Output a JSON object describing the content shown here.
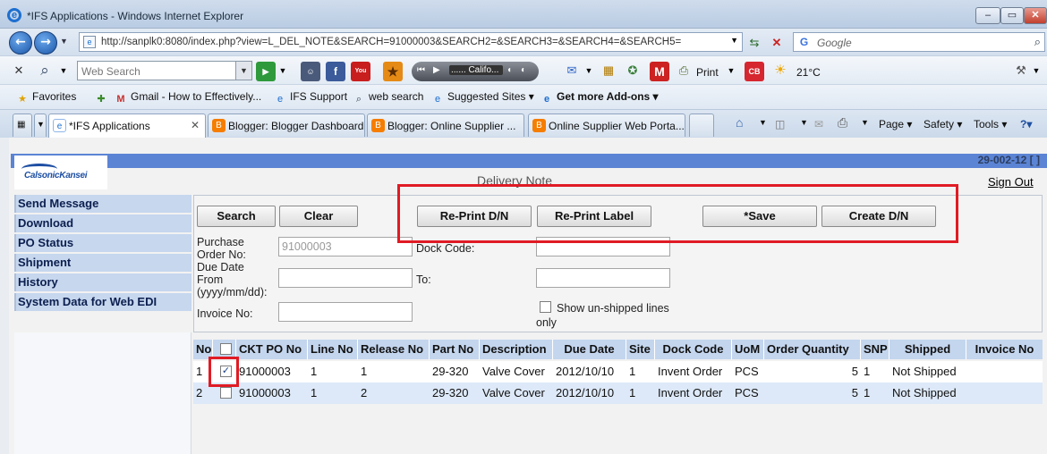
{
  "window": {
    "title": "*IFS Applications - Windows Internet Explorer",
    "controls": {
      "minimize": "–",
      "maximize": "▭",
      "close": "✕"
    }
  },
  "address": {
    "url": "http://sanplk0:8080/index.php?view=L_DEL_NOTE&SEARCH=91000003&SEARCH2=&SEARCH3=&SEARCH4=&SEARCH5=",
    "search_placeholder": "Google"
  },
  "toolbar": {
    "web_search_placeholder": "Web Search",
    "media_station": "...... Califo...",
    "print_label": "Print",
    "cb_label": "CB",
    "weather": "21°C"
  },
  "favorites": {
    "favorites_label": "Favorites",
    "items": [
      "Gmail - How to Effectively...",
      "IFS Support",
      "web search",
      "Suggested Sites ▾",
      "Get more Add-ons ▾"
    ]
  },
  "tabs": [
    {
      "label": "*IFS Applications",
      "active": true
    },
    {
      "label": "Blogger: Blogger Dashboard"
    },
    {
      "label": "Blogger: Online Supplier ..."
    },
    {
      "label": "Online Supplier Web Porta..."
    }
  ],
  "commands": {
    "page": "Page ▾",
    "safety": "Safety ▾",
    "tools": "Tools ▾",
    "help": "?▾"
  },
  "app": {
    "logo_text": "CalsonicKansei",
    "header_code": "29-002-12 [ ]",
    "page_title": "Delivery Note",
    "sign_out": "Sign Out",
    "sidebar": [
      "Send Message",
      "Download",
      "PO Status",
      "Shipment",
      "History",
      "System Data for Web EDI"
    ],
    "buttons": {
      "search": "Search",
      "clear": "Clear",
      "reprint_dn": "Re-Print D/N",
      "reprint_label": "Re-Print Label",
      "save": "*Save",
      "create_dn": "Create D/N"
    },
    "form": {
      "po_label_1": "Purchase",
      "po_label_2": "Order No:",
      "po_value": "91000003",
      "dock_code_label": "Dock Code:",
      "due_label_1": "Due Date",
      "due_label_2": "From",
      "due_label_3": "(yyyy/mm/dd):",
      "to_label": "To:",
      "invoice_label": "Invoice No:",
      "show_unshipped_1": "Show un-shipped lines",
      "show_unshipped_2": "only"
    },
    "table": {
      "columns": [
        "No",
        "",
        "CKT PO No",
        "Line No",
        "Release No",
        "Part No",
        "Description",
        "Due Date",
        "Site",
        "Dock Code",
        "UoM",
        "Order Quantity",
        "SNP",
        "Shipped",
        "Invoice No"
      ],
      "rows": [
        {
          "no": "1",
          "checked": true,
          "po": "91000003",
          "line": "1",
          "release": "1",
          "part": "29-320",
          "desc": "Valve Cover",
          "due": "2012/10/10",
          "site": "1",
          "dock": "Invent Order",
          "uom": "PCS",
          "qty": "5",
          "snp": "1",
          "shipped": "Not Shipped",
          "invoice": ""
        },
        {
          "no": "2",
          "checked": false,
          "po": "91000003",
          "line": "1",
          "release": "2",
          "part": "29-320",
          "desc": "Valve Cover",
          "due": "2012/10/10",
          "site": "1",
          "dock": "Invent Order",
          "uom": "PCS",
          "qty": "5",
          "snp": "1",
          "shipped": "Not Shipped",
          "invoice": ""
        }
      ]
    }
  },
  "colors": {
    "highlight": "#e01b24",
    "header_band": "#5b84d4",
    "nav_bg": "#c6d7ee",
    "grid_header": "#c4d6ee",
    "grid_alt_row": "#dde9f8"
  }
}
